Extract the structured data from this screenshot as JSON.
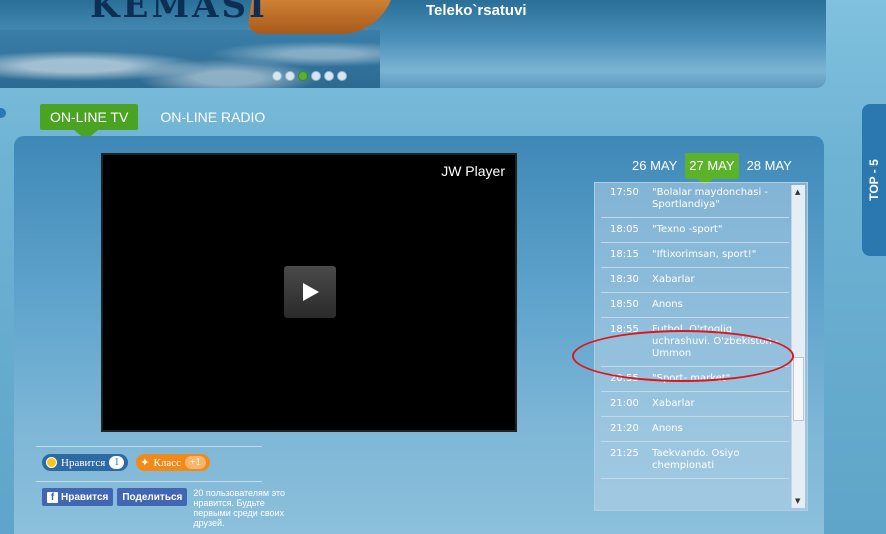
{
  "banner": {
    "logo": "KEMASI",
    "channel_name": "Teleko`rsatuvi",
    "slides": [
      {
        "active": false
      },
      {
        "active": false
      },
      {
        "active": true
      },
      {
        "active": false
      },
      {
        "active": false
      },
      {
        "active": false
      }
    ]
  },
  "tabs": {
    "online_tv": "ON-LINE TV",
    "online_radio": "ON-LINE RADIO"
  },
  "player": {
    "brand": "JW Player"
  },
  "social": {
    "like_label": "Нравится",
    "like_count": "1",
    "ok_label": "Класс",
    "ok_count": "+1",
    "fb_like": "Нравится",
    "fb_share": "Поделиться",
    "fb_text": "20 пользователям это нравится. Будьте первыми среди своих друзей."
  },
  "dates": [
    "26 MAY",
    "27 MAY",
    "28 MAY"
  ],
  "selected_date": "27 MAY",
  "schedule": [
    {
      "time": "17:50",
      "title": "\"Bolalar maydonchasi - Sportlandiya\""
    },
    {
      "time": "18:05",
      "title": "\"Texno -sport\""
    },
    {
      "time": "18:15",
      "title": "\"Iftixorimsan, sport!\""
    },
    {
      "time": "18:30",
      "title": "Xabarlar"
    },
    {
      "time": "18:50",
      "title": "Anons"
    },
    {
      "time": "18:55",
      "title": "Futbol. O'rtoqliq uchrashuvi. O'zbekiston - Ummon"
    },
    {
      "time": "20:55",
      "title": "\"Sport- market\""
    },
    {
      "time": "21:00",
      "title": "Xabarlar"
    },
    {
      "time": "21:20",
      "title": "Anons"
    },
    {
      "time": "21:25",
      "title": "Taekvando. Osiyo chempionati"
    }
  ],
  "side_tab": "TOP - 5",
  "colors": {
    "green_accent": "#4aa322",
    "highlight_circle": "#e0141c",
    "panel_blue": "#3f88b7"
  }
}
